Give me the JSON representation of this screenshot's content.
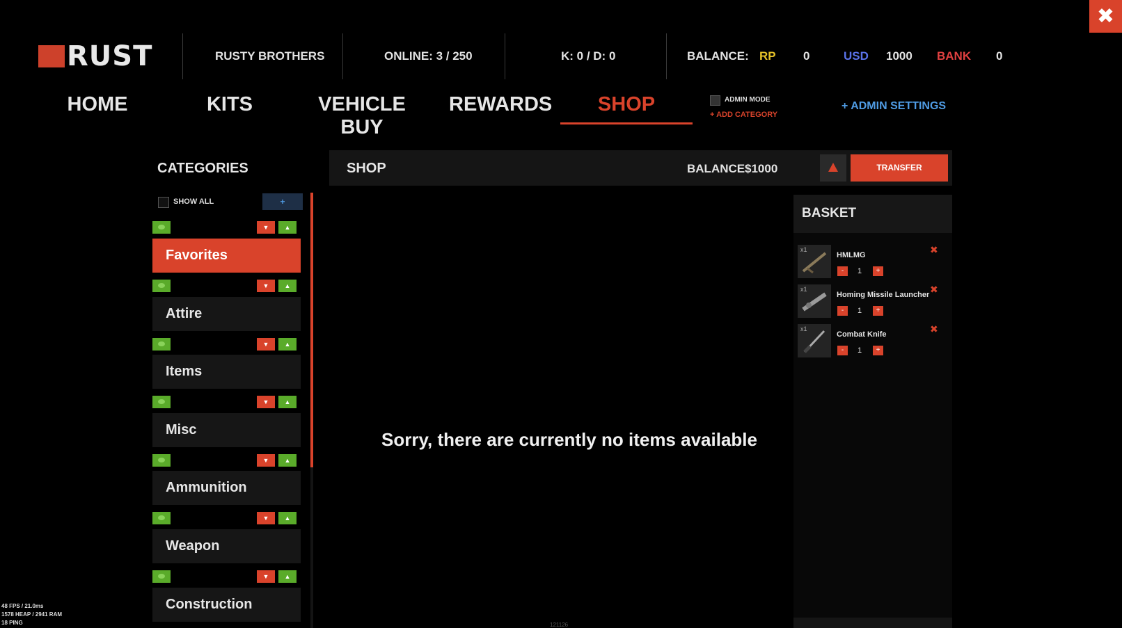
{
  "header": {
    "logo_text": "RUST",
    "server_name": "RUSTY BROTHERS",
    "online": "ONLINE: 3 / 250",
    "kd": "K: 0  / D: 0",
    "balance_label": "BALANCE:",
    "rp_label": "RP",
    "rp_value": "0",
    "usd_label": "USD",
    "usd_value": "1000",
    "bank_label": "BANK",
    "bank_value": "0",
    "colors": {
      "accent": "#d9432b",
      "rp": "#e6c228",
      "usd": "#5a72e8",
      "bank": "#e04040"
    }
  },
  "close_label": "✖",
  "nav": {
    "tabs": [
      "HOME",
      "KITS",
      "VEHICLE BUY",
      "REWARDS",
      "SHOP"
    ],
    "active": "SHOP",
    "admin_mode": "ADMIN MODE",
    "add_category": "+ ADD CATEGORY",
    "admin_settings": "+ ADMIN SETTINGS"
  },
  "categories": {
    "title": "CATEGORIES",
    "show_all": "SHOW ALL",
    "add_label": "+",
    "items": [
      "Favorites",
      "Attire",
      "Items",
      "Misc",
      "Ammunition",
      "Weapon",
      "Construction"
    ],
    "active": "Favorites"
  },
  "shop": {
    "title": "SHOP",
    "balance_label": "BALANCE",
    "balance_value": "$1000",
    "transfer_label": "TRANSFER",
    "empty_message": "Sorry, there are currently no items available"
  },
  "basket": {
    "title": "BASKET",
    "items": [
      {
        "tag": "x1",
        "name": "HMLMG",
        "qty": "1",
        "minus": "-",
        "plus": "+",
        "remove": "✖"
      },
      {
        "tag": "x1",
        "name": "Homing Missile Launcher",
        "qty": "1",
        "minus": "-",
        "plus": "+",
        "remove": "✖"
      },
      {
        "tag": "x1",
        "name": "Combat Knife",
        "qty": "1",
        "minus": "-",
        "plus": "+",
        "remove": "✖"
      }
    ]
  },
  "debug": {
    "fps": "48 FPS / 21.0ms",
    "heap": "1578 HEAP / 2941 RAM",
    "ping": "18 PING",
    "center_code": "121126"
  }
}
